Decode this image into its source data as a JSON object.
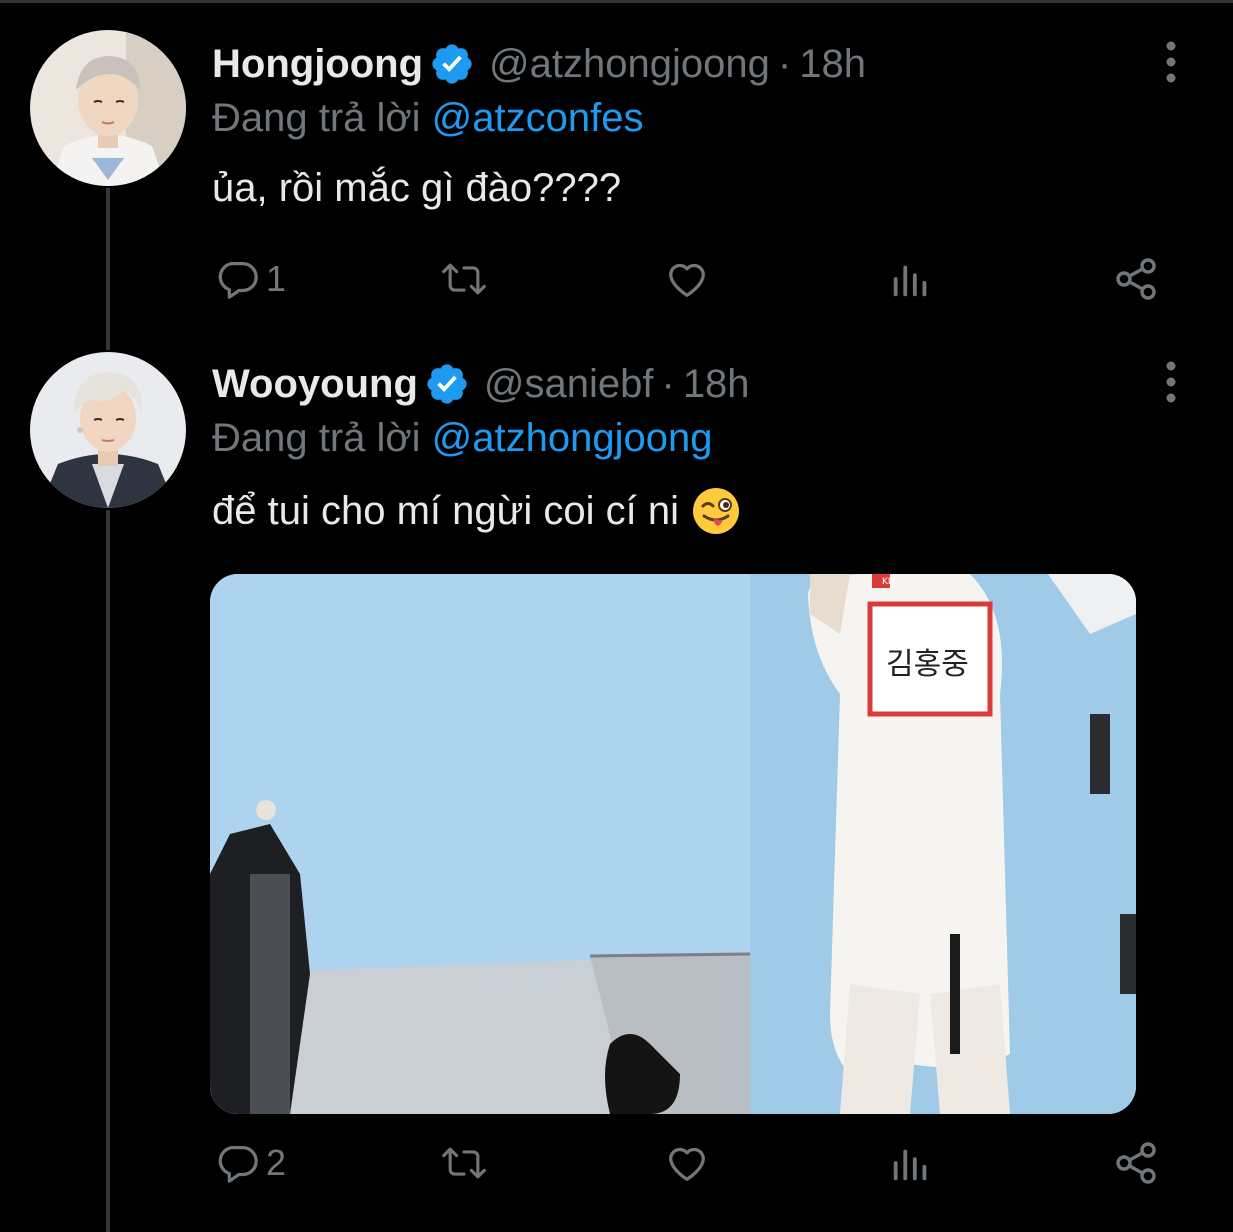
{
  "theme": {
    "background": "#000000",
    "text": "#e7e9ea",
    "secondary": "#71767b",
    "accent": "#1d9bf0",
    "divider": "#333639"
  },
  "tweets": [
    {
      "author": {
        "name": "Hongjoong",
        "handle": "@atzhongjoong",
        "verified": true,
        "avatar_icon": "avatar-hongjoong"
      },
      "separator": "·",
      "time": "18h",
      "reply_prefix": "Đang trả lời",
      "reply_to": "@atzconfes",
      "text": "ủa, rồi mắc gì đào????",
      "emoji": null,
      "actions": {
        "reply_count": "1",
        "retweet_count": "",
        "like_count": "",
        "icons": [
          "reply-icon",
          "retweet-icon",
          "like-icon",
          "analytics-icon",
          "share-icon"
        ]
      }
    },
    {
      "author": {
        "name": "Wooyoung",
        "handle": "@saniebf",
        "verified": true,
        "avatar_icon": "avatar-wooyoung"
      },
      "separator": "·",
      "time": "18h",
      "reply_prefix": "Đang trả lời",
      "reply_to": "@atzhongjoong",
      "text": "để tui cho mí ngừi coi cí ni",
      "emoji": "winking-face-with-tongue",
      "media": {
        "type": "photo",
        "sign_text": "김홍중",
        "sign_corner_text": "KD"
      },
      "actions": {
        "reply_count": "2",
        "retweet_count": "",
        "like_count": "",
        "icons": [
          "reply-icon",
          "retweet-icon",
          "like-icon",
          "analytics-icon",
          "share-icon"
        ]
      }
    }
  ]
}
